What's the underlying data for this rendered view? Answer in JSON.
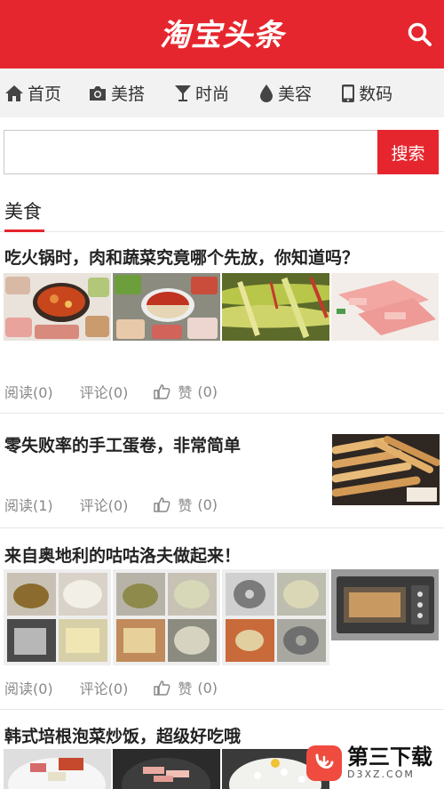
{
  "header": {
    "logo_text": "淘宝头条"
  },
  "nav": [
    {
      "label": "首页",
      "icon": "home-icon"
    },
    {
      "label": "美搭",
      "icon": "camera-icon"
    },
    {
      "label": "时尚",
      "icon": "cocktail-icon"
    },
    {
      "label": "美容",
      "icon": "drop-icon"
    },
    {
      "label": "数码",
      "icon": "phone-icon"
    }
  ],
  "search": {
    "value": "",
    "placeholder": "",
    "button_label": "搜索"
  },
  "section": {
    "title": "美食"
  },
  "articles": [
    {
      "title": "吃火锅时，肉和蔬菜究竟哪个先放，你知道吗？",
      "read": "阅读(0)",
      "comment": "评论(0)",
      "like_label": "赞",
      "like": "(0)"
    },
    {
      "title": "零失败率的手工蛋卷，非常简单",
      "read": "阅读(1)",
      "comment": "评论(0)",
      "like_label": "赞",
      "like": "(0)"
    },
    {
      "title": "来自奥地利的咕咕洛夫做起来！",
      "read": "阅读(0)",
      "comment": "评论(0)",
      "like_label": "赞",
      "like": "(0)"
    },
    {
      "title": "韩式培根泡菜炒饭，超级好吃哦",
      "read": "",
      "comment": "",
      "like_label": "",
      "like": ""
    }
  ],
  "watermark": {
    "title": "第三下载",
    "url": "D3XZ.COM"
  },
  "colors": {
    "brand": "#e6262e",
    "nav_bg": "#f2f2f2",
    "meta": "#888888"
  }
}
